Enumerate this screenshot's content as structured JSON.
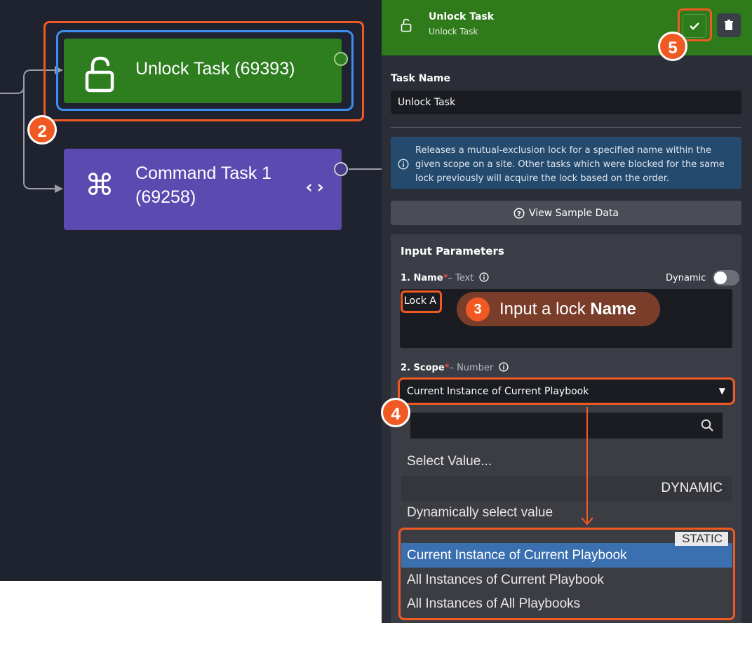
{
  "canvas": {
    "unlock_node": {
      "title": "Unlock Task (69393)"
    },
    "command_node": {
      "title": "Command Task 1 (69258)"
    }
  },
  "panel": {
    "header": {
      "title": "Unlock Task",
      "subtitle": "Unlock Task"
    },
    "task_name_label": "Task Name",
    "task_name_value": "Unlock Task",
    "info_text": "Releases a mutual-exclusion lock for a specified name within the given scope on a site. Other tasks which were blocked for the same lock previously will acquire the lock based on the order.",
    "view_sample_label": "View Sample Data",
    "input_params_title": "Input Parameters",
    "name_param": {
      "label": "1. Name",
      "required": "*",
      "type": "– Text",
      "dynamic_label": "Dynamic",
      "value": "Lock A"
    },
    "scope_param": {
      "label": "2. Scope",
      "required": "*",
      "type": "– Number",
      "selected": "Current Instance of Current Playbook"
    }
  },
  "dropdown": {
    "placeholder_item": "Select Value...",
    "dynamic_group": "DYNAMIC",
    "dynamic_item": "Dynamically select value",
    "static_group": "STATIC",
    "options": [
      "Current Instance of Current Playbook",
      "All Instances of Current Playbook",
      "All Instances of All Playbooks"
    ]
  },
  "annotations": {
    "step2": "2",
    "step3": "3",
    "step3_text": "Input a lock ",
    "step3_bold": "Name",
    "step4": "4",
    "step5": "5"
  },
  "colors": {
    "accent_orange": "#f05a22",
    "unlock_green": "#2e7d1f",
    "command_purple": "#5b4bb0",
    "selection_blue": "#3d8ef0"
  }
}
